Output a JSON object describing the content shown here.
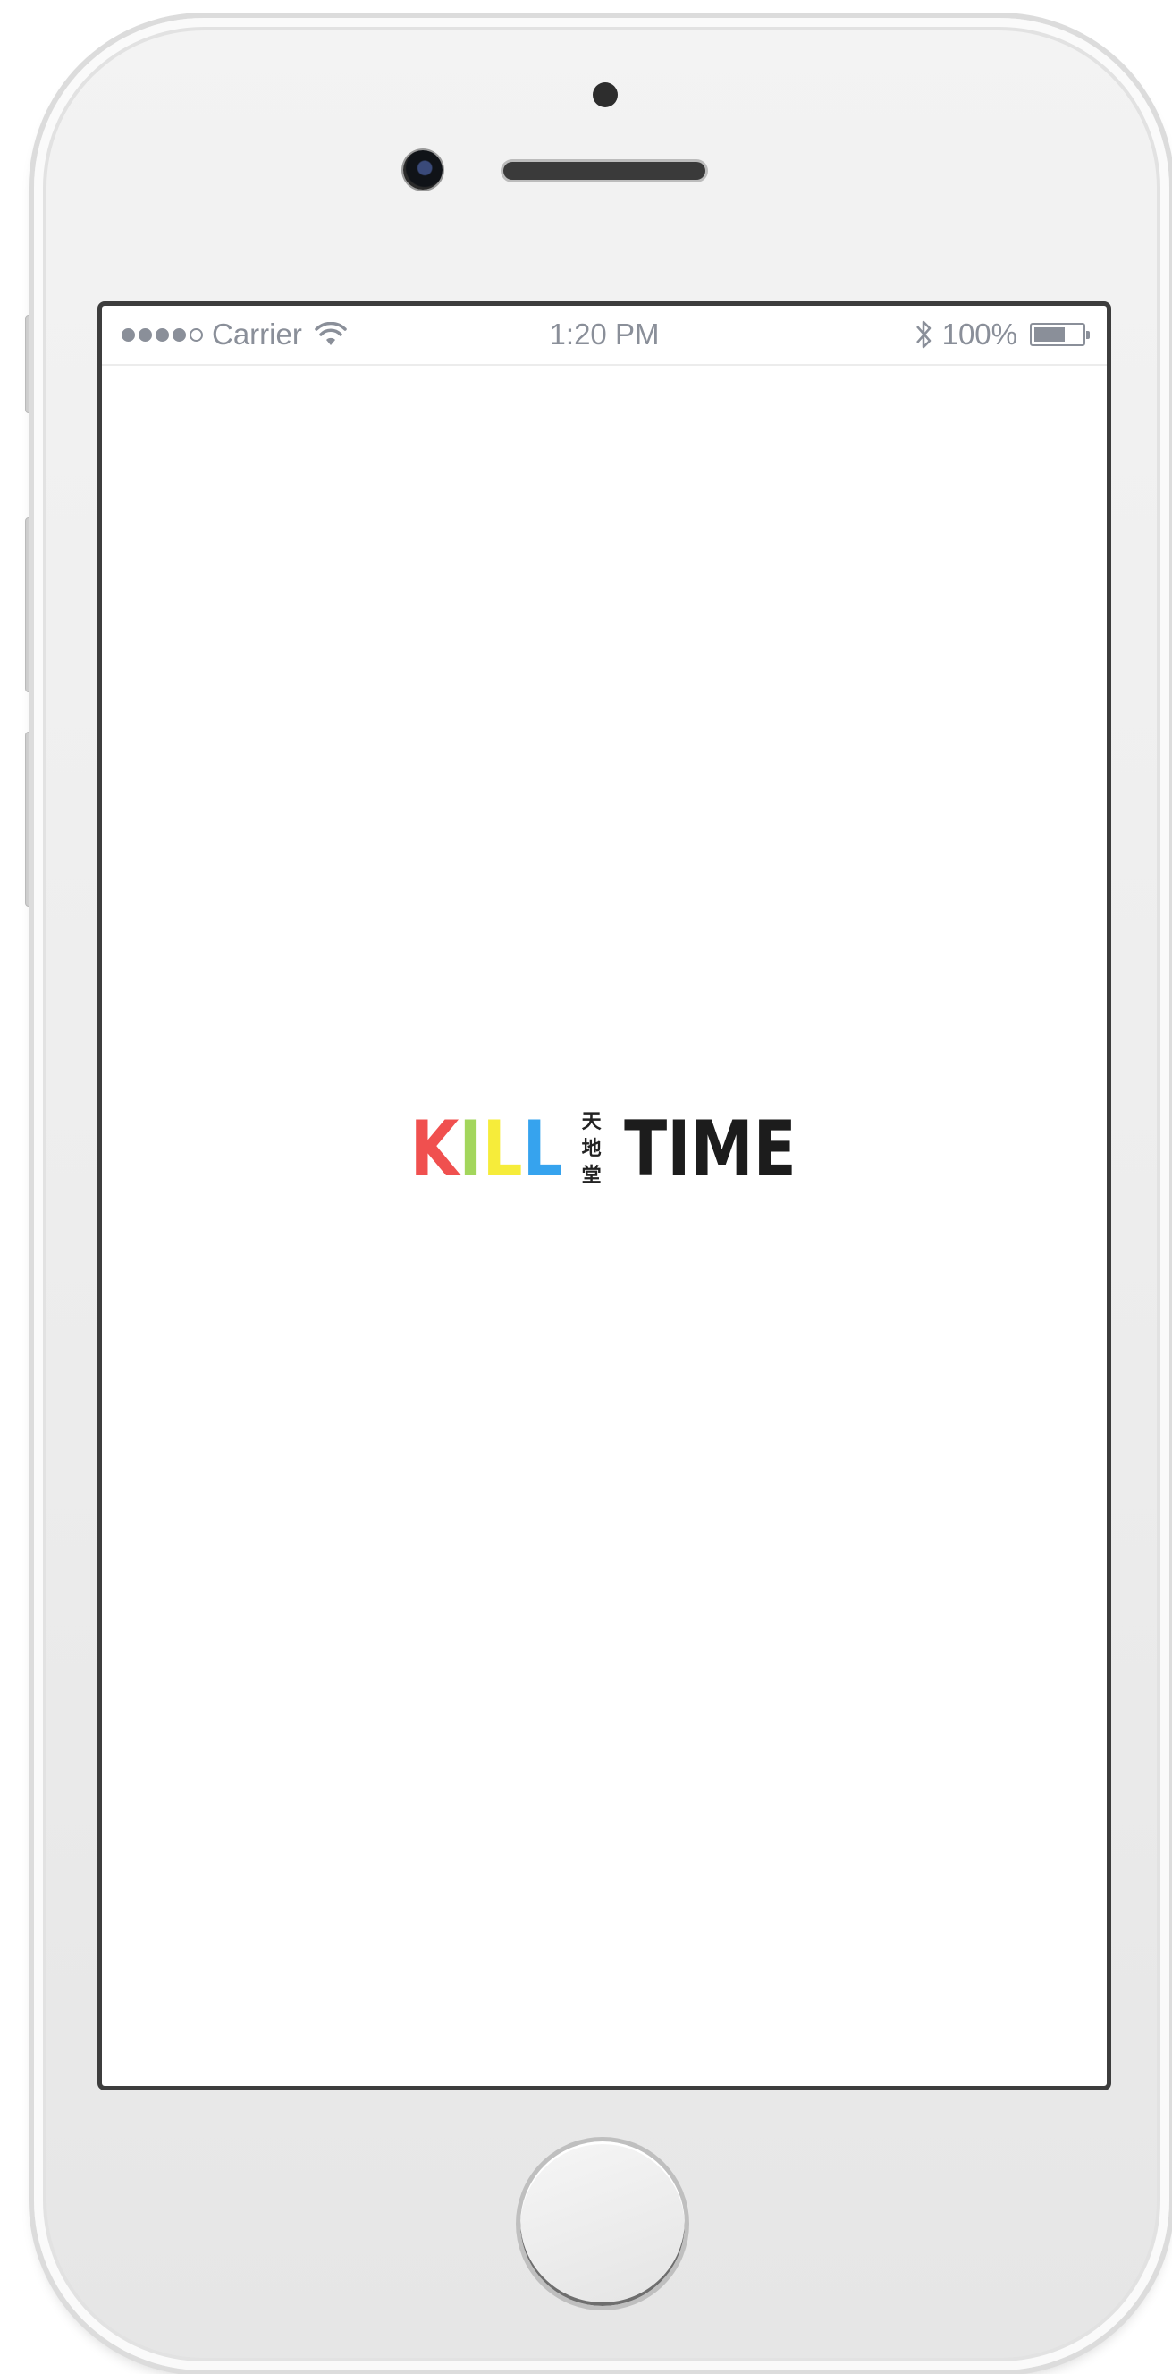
{
  "status_bar": {
    "carrier": "Carrier",
    "time": "1:20 PM",
    "battery": "100%",
    "signal_bars_filled": 4,
    "signal_bars_total": 5
  },
  "logo": {
    "kill_letters": [
      {
        "char": "K",
        "color": "#f0504f"
      },
      {
        "char": "I",
        "color": "#a3d65c"
      },
      {
        "char": "L",
        "color": "#f6ec3a"
      },
      {
        "char": "L",
        "color": "#36a3ee"
      }
    ],
    "chinese": [
      "天",
      "地",
      "堂"
    ],
    "time_word": "TIME"
  },
  "icons": {
    "wifi": "wifi-icon",
    "bluetooth": "bluetooth-icon",
    "battery": "battery-icon",
    "home": "home-button"
  },
  "colors": {
    "status_text": "#8a8f99",
    "screen_border": "#3d3d3d"
  }
}
